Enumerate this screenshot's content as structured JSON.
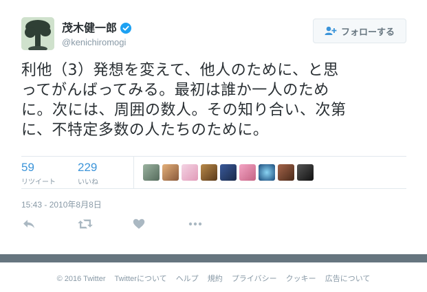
{
  "user": {
    "fullname": "茂木健一郎",
    "screen_name": "@kenichiromogi",
    "verified_icon": "verified-badge-icon"
  },
  "follow_button": {
    "label": "フォローする",
    "icon": "add-user-icon"
  },
  "tweet": {
    "lines": [
      "利他（3）発想を変えて、他人のために、と思",
      "ってがんばってみる。最初は誰か一人のため",
      "に。次には、周囲の数人。その知り合い、次第",
      "に、不特定多数の人たちのために。"
    ]
  },
  "stats": {
    "retweets": {
      "value": "59",
      "label": "リツイート"
    },
    "likes": {
      "value": "229",
      "label": "いいね"
    }
  },
  "timestamp": "15:43 - 2010年8月8日",
  "actions": {
    "reply_icon": "reply-icon",
    "retweet_icon": "retweet-icon",
    "like_icon": "heart-icon",
    "more_icon": "more-icon"
  },
  "footer": {
    "links": [
      "© 2016 Twitter",
      "Twitterについて",
      "ヘルプ",
      "規約",
      "プライバシー",
      "クッキー",
      "広告について"
    ]
  },
  "colors": {
    "link_blue": "#3b94d9",
    "muted": "#8899a6",
    "text": "#292f33",
    "verified": "#1da1f2",
    "footer_bar": "#66757f"
  }
}
